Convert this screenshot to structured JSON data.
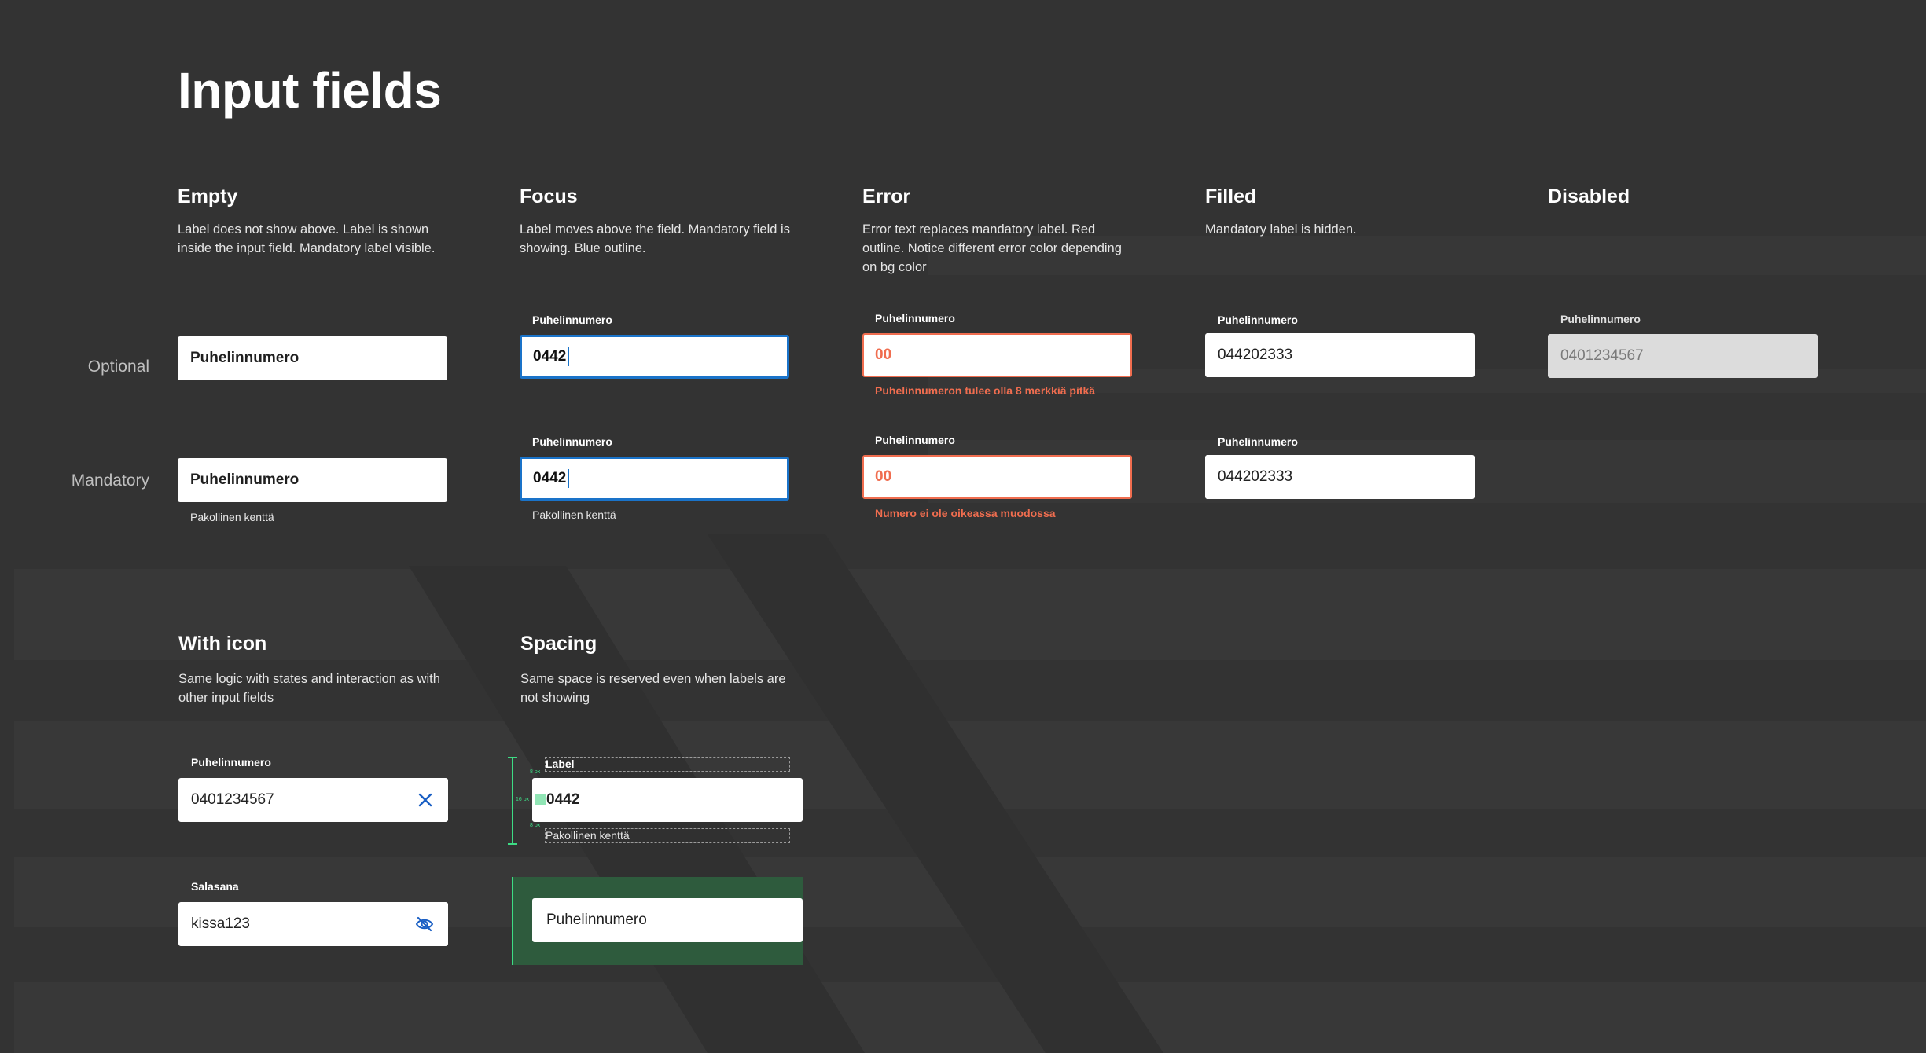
{
  "page": {
    "title": "Input fields"
  },
  "columns": {
    "empty": {
      "title": "Empty",
      "desc": "Label does not show above. Label is shown inside the input field.  Mandatory label visible."
    },
    "focus": {
      "title": "Focus",
      "desc": "Label moves above the field. Mandatory field is showing.  Blue outline."
    },
    "error": {
      "title": "Error",
      "desc": "Error text replaces mandatory label. Red outline. Notice different error color depending on bg color"
    },
    "filled": {
      "title": "Filled",
      "desc": "Mandatory label is hidden."
    },
    "disabled": {
      "title": "Disabled",
      "desc": ""
    }
  },
  "rows": {
    "optional": "Optional",
    "mandatory": "Mandatory"
  },
  "fields": {
    "label": "Puhelinnumero",
    "placeholder": "Puhelinnumero",
    "focus_value": "0442",
    "error_value": "00",
    "filled_value": "044202333",
    "disabled_value": "0401234567",
    "mandatory_helper": "Pakollinen kenttä",
    "error_optional": "Puhelinnumeron tulee olla 8 merkkiä pitkä",
    "error_mandatory": "Numero ei ole oikeassa muodossa"
  },
  "with_icon": {
    "title": "With icon",
    "desc": "Same logic with states and interaction as with other input fields",
    "phone_label": "Puhelinnumero",
    "phone_value": "0401234567",
    "phone_icon": "close-icon",
    "password_label": "Salasana",
    "password_value": "kissa123",
    "password_icon": "eye-hidden-icon"
  },
  "spacing": {
    "title": "Spacing",
    "desc": "Same space is reserved even when labels are not showing",
    "label": "Label",
    "value": "0442",
    "helper": "Pakollinen kenttä",
    "placeholder": "Puhelinnumero",
    "top_gap": "8 px",
    "side_pad": "16 px",
    "bottom_gap": "8 px"
  },
  "colors": {
    "background": "#333333",
    "focus_outline": "#1a73c9",
    "error": "#f06d4f",
    "spacing_guide": "#3ddc84"
  }
}
